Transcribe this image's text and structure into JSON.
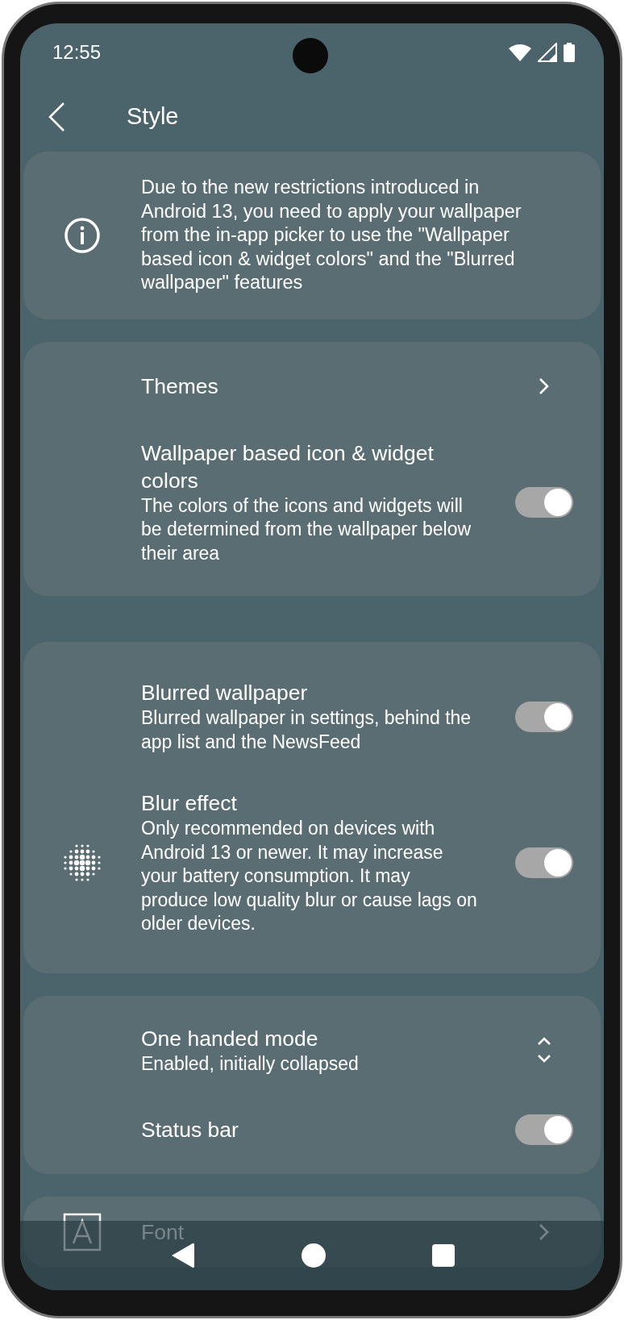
{
  "status_bar": {
    "time": "12:55"
  },
  "header": {
    "title": "Style"
  },
  "notice": {
    "text": "Due to the new restrictions introduced in Android 13, you need to apply your wallpaper from the in-app picker to use the \"Wallpaper based icon & widget colors\" and the \"Blurred wallpaper\" features"
  },
  "sections": [
    {
      "items": [
        {
          "kind": "link",
          "title": "Themes"
        },
        {
          "kind": "toggle",
          "title": "Wallpaper based icon & widget colors",
          "subtitle": "The colors of the icons and widgets will be determined from the wallpaper below their area",
          "on": true
        }
      ]
    },
    {
      "items": [
        {
          "kind": "toggle",
          "title": "Blurred wallpaper",
          "subtitle": "Blurred wallpaper in settings, behind the app list and the NewsFeed",
          "on": true
        },
        {
          "kind": "toggle",
          "title": "Blur effect",
          "subtitle": "Only recommended on devices with Android 13 or newer. It may increase your battery consumption. It may produce low quality blur or cause lags on older devices.",
          "on": true
        }
      ]
    },
    {
      "items": [
        {
          "kind": "select",
          "title": "One handed mode",
          "subtitle": "Enabled, initially collapsed"
        },
        {
          "kind": "toggle",
          "title": "Status bar",
          "on": true
        }
      ]
    },
    {
      "items": [
        {
          "kind": "link",
          "title": "Font"
        }
      ]
    }
  ]
}
